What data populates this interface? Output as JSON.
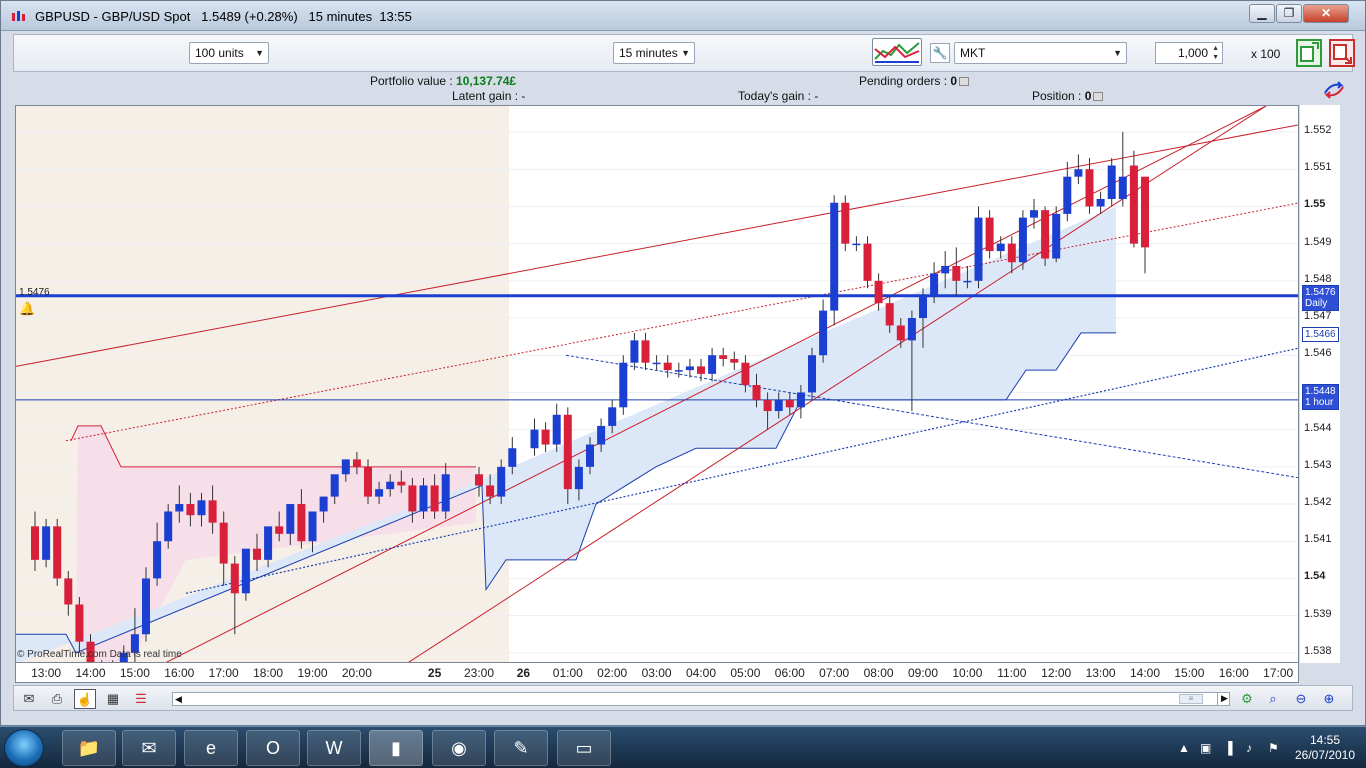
{
  "window": {
    "title": "GBPUSD - GBP/USD Spot",
    "price": "1.5489 (+0.28%)",
    "interval_label": "15 minutes",
    "time": "13:55"
  },
  "toolbar": {
    "units_value": "100 units",
    "interval_value": "15 minutes",
    "order_type_value": "MKT",
    "quantity_value": "1,000",
    "multiplier": "x 100"
  },
  "info": {
    "portfolio_label": "Portfolio value : ",
    "portfolio_value": "10,137.74£",
    "pending_label": "Pending orders : ",
    "pending_value": "0",
    "latent_label": "Latent gain : ",
    "latent_value": "-",
    "todays_label": "Today's gain : ",
    "todays_value": "-",
    "position_label": "Position : ",
    "position_value": "0"
  },
  "chart": {
    "watermark": "© ProRealTime.com  Data is real time",
    "hline_label": "1.5476",
    "price_ticks": [
      "1.552",
      "1.551",
      "1.55",
      "1.549",
      "1.548",
      "1.547",
      "1.546",
      "1.545",
      "1.544",
      "1.543",
      "1.542",
      "1.541",
      "1.54",
      "1.539",
      "1.538"
    ],
    "tags": {
      "daily_value": "1.5476",
      "daily_label": "Daily",
      "cloud_value": "1.5466",
      "hour_value": "1.5448",
      "hour_label": "1 hour"
    },
    "time_ticks": [
      "13:00",
      "14:00",
      "15:00",
      "16:00",
      "17:00",
      "18:00",
      "19:00",
      "20:00",
      "25",
      "23:00",
      "26",
      "01:00",
      "02:00",
      "03:00",
      "04:00",
      "05:00",
      "06:00",
      "07:00",
      "08:00",
      "09:00",
      "10:00",
      "11:00",
      "12:00",
      "13:00",
      "14:00",
      "15:00",
      "16:00",
      "17:00"
    ],
    "colors": {
      "up": "#1b3fd0",
      "down": "#d8203a",
      "cloud": "#dce8f8",
      "pink": "#f6dfe8",
      "shade": "#f5efe8"
    }
  },
  "chart_data": {
    "type": "candlestick",
    "title": "GBPUSD - GBP/USD Spot",
    "xlabel": "",
    "ylabel": "",
    "ylim": [
      1.5377,
      1.5527
    ],
    "x": [
      "24 12:45",
      "24 13:00",
      "24 13:15",
      "24 13:30",
      "24 13:45",
      "24 14:00",
      "24 14:15",
      "24 14:30",
      "24 14:45",
      "24 15:00",
      "24 15:15",
      "24 15:30",
      "24 15:45",
      "24 16:00",
      "24 16:15",
      "24 16:30",
      "24 16:45",
      "24 17:00",
      "24 17:15",
      "24 17:30",
      "24 17:45",
      "24 18:00",
      "24 18:15",
      "24 18:30",
      "24 18:45",
      "24 19:00",
      "24 19:15",
      "24 19:30",
      "24 19:45",
      "24 20:00",
      "24 20:15",
      "24 20:30",
      "24 20:45",
      "24 21:00",
      "24 21:15",
      "24 21:30",
      "24 21:45",
      "24 22:00",
      "24 22:45",
      "24 23:00",
      "24 23:15",
      "24 23:30",
      "26 00:00",
      "26 00:15",
      "26 00:30",
      "26 00:45",
      "26 01:00",
      "26 01:15",
      "26 01:30",
      "26 01:45",
      "26 02:00",
      "26 02:15",
      "26 02:30",
      "26 02:45",
      "26 03:00",
      "26 03:15",
      "26 03:30",
      "26 03:45",
      "26 04:00",
      "26 04:15",
      "26 04:30",
      "26 04:45",
      "26 05:00",
      "26 05:15",
      "26 05:30",
      "26 05:45",
      "26 06:00",
      "26 06:15",
      "26 06:30",
      "26 06:45",
      "26 07:00",
      "26 07:15",
      "26 07:30",
      "26 07:45",
      "26 08:00",
      "26 08:15",
      "26 08:30",
      "26 08:45",
      "26 09:00",
      "26 09:15",
      "26 09:30",
      "26 09:45",
      "26 10:00",
      "26 10:15",
      "26 10:30",
      "26 10:45",
      "26 11:00",
      "26 11:15",
      "26 11:30",
      "26 11:45",
      "26 12:00",
      "26 12:15",
      "26 12:30",
      "26 12:45",
      "26 13:00",
      "26 13:15",
      "26 13:30",
      "26 13:45"
    ],
    "open": [
      1.5414,
      1.5405,
      1.5414,
      1.54,
      1.5393,
      1.5383,
      1.5374,
      1.5376,
      1.5376,
      1.538,
      1.5385,
      1.54,
      1.541,
      1.5418,
      1.542,
      1.5417,
      1.5421,
      1.5415,
      1.5404,
      1.5396,
      1.5408,
      1.5405,
      1.5414,
      1.5412,
      1.542,
      1.541,
      1.5418,
      1.5422,
      1.5428,
      1.5432,
      1.543,
      1.5422,
      1.5424,
      1.5426,
      1.5425,
      1.5418,
      1.5425,
      1.5418,
      1.5428,
      1.5425,
      1.5422,
      1.543,
      1.5435,
      1.544,
      1.5436,
      1.5444,
      1.5424,
      1.543,
      1.5436,
      1.5441,
      1.5446,
      1.5458,
      1.5464,
      1.5458,
      1.5458,
      1.5456,
      1.5456,
      1.5457,
      1.5455,
      1.546,
      1.5459,
      1.5458,
      1.5452,
      1.5448,
      1.5445,
      1.5448,
      1.5446,
      1.545,
      1.546,
      1.5472,
      1.5501,
      1.549,
      1.549,
      1.548,
      1.5474,
      1.5468,
      1.5464,
      1.547,
      1.5476,
      1.5482,
      1.5484,
      1.548,
      1.548,
      1.5497,
      1.5488,
      1.549,
      1.5485,
      1.5497,
      1.5499,
      1.5486,
      1.5498,
      1.5508,
      1.551,
      1.55,
      1.5502,
      1.5502,
      1.5511,
      1.5508
    ],
    "close": [
      1.5405,
      1.5414,
      1.54,
      1.5393,
      1.5383,
      1.5374,
      1.5376,
      1.5376,
      1.538,
      1.5385,
      1.54,
      1.541,
      1.5418,
      1.542,
      1.5417,
      1.5421,
      1.5415,
      1.5404,
      1.5396,
      1.5408,
      1.5405,
      1.5414,
      1.5412,
      1.542,
      1.541,
      1.5418,
      1.5422,
      1.5428,
      1.5432,
      1.543,
      1.5422,
      1.5424,
      1.5426,
      1.5425,
      1.5418,
      1.5425,
      1.5418,
      1.5428,
      1.5425,
      1.5422,
      1.543,
      1.5435,
      1.544,
      1.5436,
      1.5444,
      1.5424,
      1.543,
      1.5436,
      1.5441,
      1.5446,
      1.5458,
      1.5464,
      1.5458,
      1.5458,
      1.5456,
      1.5456,
      1.5457,
      1.5455,
      1.546,
      1.5459,
      1.5458,
      1.5452,
      1.5448,
      1.5445,
      1.5448,
      1.5446,
      1.545,
      1.546,
      1.5472,
      1.5501,
      1.549,
      1.549,
      1.548,
      1.5474,
      1.5468,
      1.5464,
      1.547,
      1.5476,
      1.5482,
      1.5484,
      1.548,
      1.548,
      1.5497,
      1.5488,
      1.549,
      1.5485,
      1.5497,
      1.5499,
      1.5486,
      1.5498,
      1.5508,
      1.551,
      1.55,
      1.5502,
      1.5511,
      1.5508,
      1.549,
      1.5489
    ],
    "high": [
      1.5418,
      1.5416,
      1.5416,
      1.5402,
      1.5395,
      1.5385,
      1.5378,
      1.5378,
      1.5382,
      1.5392,
      1.5403,
      1.5415,
      1.542,
      1.5425,
      1.5423,
      1.5423,
      1.5425,
      1.5418,
      1.5406,
      1.5398,
      1.5412,
      1.5409,
      1.5418,
      1.5416,
      1.5424,
      1.5415,
      1.5422,
      1.5426,
      1.5432,
      1.5434,
      1.5432,
      1.5426,
      1.5428,
      1.5429,
      1.5427,
      1.5427,
      1.5428,
      1.5431,
      1.543,
      1.5428,
      1.5432,
      1.5438,
      1.5443,
      1.5442,
      1.5447,
      1.5446,
      1.5432,
      1.5438,
      1.5443,
      1.5448,
      1.546,
      1.5466,
      1.5466,
      1.546,
      1.546,
      1.5458,
      1.5459,
      1.5459,
      1.5462,
      1.5462,
      1.5461,
      1.546,
      1.5455,
      1.545,
      1.545,
      1.545,
      1.5452,
      1.5462,
      1.5475,
      1.5503,
      1.5503,
      1.5492,
      1.5492,
      1.5482,
      1.5476,
      1.547,
      1.5472,
      1.5478,
      1.5485,
      1.5488,
      1.5489,
      1.5484,
      1.55,
      1.5499,
      1.5492,
      1.5492,
      1.5499,
      1.5502,
      1.55,
      1.55,
      1.5512,
      1.5514,
      1.5513,
      1.5504,
      1.5513,
      1.552,
      1.5515,
      1.5494
    ],
    "low": [
      1.5402,
      1.5403,
      1.5398,
      1.539,
      1.538,
      1.5372,
      1.5372,
      1.5374,
      1.5374,
      1.5377,
      1.5383,
      1.5398,
      1.5408,
      1.5415,
      1.5414,
      1.5414,
      1.5412,
      1.5398,
      1.5385,
      1.5394,
      1.5402,
      1.5403,
      1.541,
      1.5409,
      1.5408,
      1.5407,
      1.5415,
      1.542,
      1.5426,
      1.5428,
      1.542,
      1.542,
      1.5422,
      1.5423,
      1.5415,
      1.5416,
      1.5416,
      1.5416,
      1.5422,
      1.542,
      1.542,
      1.5428,
      1.5433,
      1.5434,
      1.5434,
      1.542,
      1.5421,
      1.5428,
      1.5434,
      1.5439,
      1.5444,
      1.5456,
      1.5456,
      1.5456,
      1.5454,
      1.5454,
      1.5454,
      1.5453,
      1.5453,
      1.5457,
      1.5456,
      1.545,
      1.5446,
      1.544,
      1.5443,
      1.5444,
      1.5443,
      1.5448,
      1.5458,
      1.5468,
      1.5488,
      1.5488,
      1.5478,
      1.5472,
      1.5466,
      1.5462,
      1.5445,
      1.5462,
      1.5474,
      1.5478,
      1.5476,
      1.5478,
      1.5478,
      1.5486,
      1.5486,
      1.5482,
      1.5483,
      1.5494,
      1.5484,
      1.5485,
      1.5496,
      1.5506,
      1.5498,
      1.5498,
      1.55,
      1.55,
      1.5489,
      1.5482
    ]
  },
  "bottombar": {
    "tools": [
      "envelope-icon",
      "printer-icon",
      "hand-icon",
      "calculator-icon",
      "list-icon"
    ],
    "right_tools": [
      "settings-icon",
      "zoom-fit-icon",
      "zoom-out-icon",
      "zoom-in-icon"
    ]
  },
  "taskbar": {
    "clock_time": "14:55",
    "clock_date": "26/07/2010"
  }
}
